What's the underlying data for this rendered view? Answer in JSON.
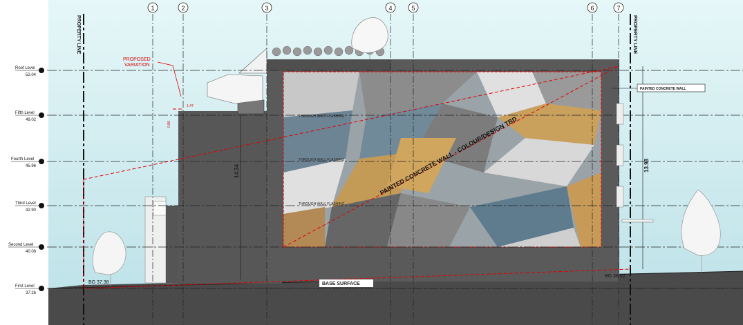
{
  "property_line": "PROPERTY LINE",
  "levels": [
    {
      "id": "roof",
      "name": "Roof Level",
      "value": "52.04"
    },
    {
      "id": "fifth",
      "name": "Fifth Level",
      "value": "49.02"
    },
    {
      "id": "fourth",
      "name": "Fourth Level",
      "value": "45.96"
    },
    {
      "id": "third",
      "name": "Third Level",
      "value": "42.90"
    },
    {
      "id": "second",
      "name": "Second Level",
      "value": "40.08"
    },
    {
      "id": "first",
      "name": "First Level",
      "value": "37.26"
    }
  ],
  "gridlines": [
    "1",
    "2",
    "3",
    "4",
    "5",
    "6",
    "7"
  ],
  "proposed_variation": [
    "PROPOSED",
    "VARIATION"
  ],
  "dim_horizontal": "1.47",
  "dim_vertical_small": "0.80",
  "dim_left_height": "14.34",
  "dim_right_height": "13.98",
  "mural_label": "PAINTED CONCRETE WALL - COLOUR/DESIGN TBD",
  "flashing_label": "THROUGH WALL FLASHING",
  "wall_callout": "PAINTED CONCRETE WALL",
  "base_surface": "BASE SURFACE",
  "bg_left": "BG 37.38",
  "bg_right": "BG 38.52",
  "colors": {
    "sky": "#c9ebef",
    "building": "#555555",
    "ground": "#4a4a4a",
    "mural_blue": "#5e7b8e",
    "mural_orange": "#c79a58",
    "mural_white": "#d8d8d8",
    "red_line": "#e00000"
  }
}
